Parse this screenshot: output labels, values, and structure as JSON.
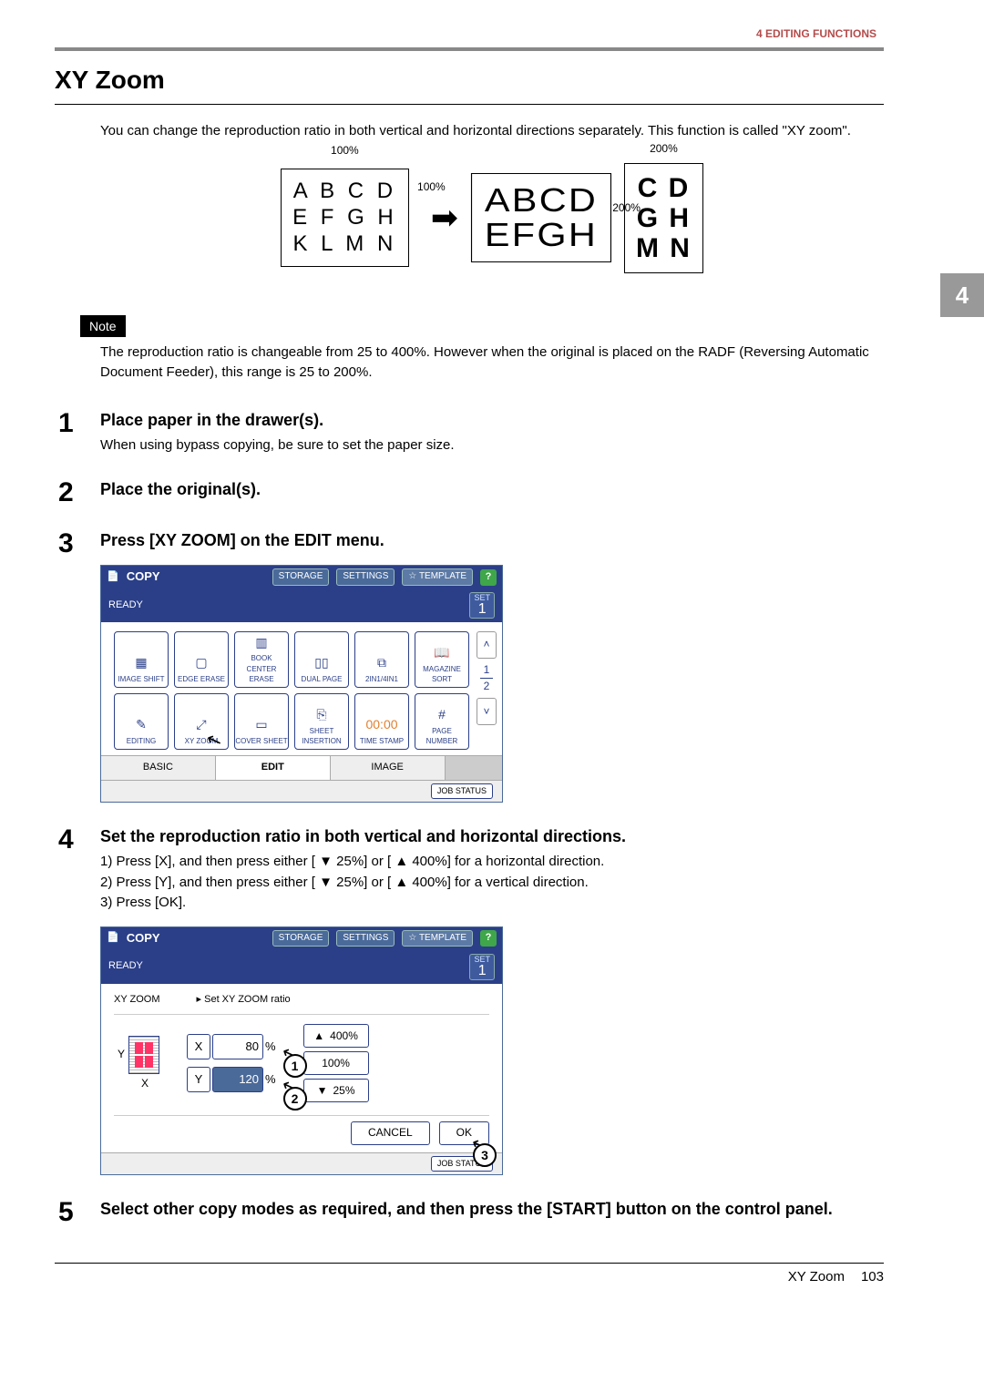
{
  "header": {
    "crumb": "4 EDITING FUNCTIONS",
    "chapter_tab": "4"
  },
  "title": "XY Zoom",
  "intro": "You can change the reproduction ratio in both vertical and horizontal directions separately. This function is called \"XY zoom\".",
  "figure": {
    "pct100_top": "100%",
    "pct100_side": "100%",
    "pct200_side": "200%",
    "pct200_top": "200%",
    "rows_orig": [
      "A B C D",
      "E F G H",
      "K L M N"
    ],
    "rows_wide": [
      "ABCD",
      "EFGH"
    ],
    "rows_tall": [
      "C D",
      "G H",
      "M N"
    ]
  },
  "note": {
    "label": "Note",
    "text": "The reproduction ratio is changeable from 25 to 400%. However when the original is placed on the RADF (Reversing Automatic Document Feeder), this range is 25 to 200%."
  },
  "steps": {
    "s1": {
      "num": "1",
      "heading": "Place paper in the drawer(s).",
      "text": "When using bypass copying, be sure to set the paper size."
    },
    "s2": {
      "num": "2",
      "heading": "Place the original(s)."
    },
    "s3": {
      "num": "3",
      "heading": "Press [XY ZOOM] on the EDIT menu."
    },
    "s4": {
      "num": "4",
      "heading": "Set the reproduction ratio in both vertical and horizontal directions.",
      "l1": "1)  Press [X], and then press either [ ▼ 25%] or [ ▲ 400%] for a horizontal direction.",
      "l2": "2)  Press [Y], and then press either [ ▼ 25%] or [ ▲ 400%] for a vertical direction.",
      "l3": "3)  Press [OK]."
    },
    "s5": {
      "num": "5",
      "heading": "Select other copy modes as required, and then press the [START] button on the control panel."
    }
  },
  "panel_common": {
    "copy": "COPY",
    "storage": "STORAGE",
    "settings": "SETTINGS",
    "template": "☆ TEMPLATE",
    "ready": "READY",
    "set": "SET",
    "one": "1",
    "job_status": "JOB STATUS"
  },
  "edit_panel": {
    "cells": [
      "IMAGE SHIFT",
      "EDGE ERASE",
      "BOOK CENTER ERASE",
      "DUAL PAGE",
      "2IN1/4IN1",
      "MAGAZINE SORT",
      "EDITING",
      "XY ZOOM",
      "COVER SHEET",
      "SHEET INSERTION",
      "TIME STAMP",
      "PAGE NUMBER"
    ],
    "time_stamp_icon": "00:00",
    "side": {
      "up": "˄",
      "p1": "1",
      "p2": "2",
      "down": "˅"
    },
    "tabs": {
      "basic": "BASIC",
      "edit": "EDIT",
      "image": "IMAGE"
    }
  },
  "ratio_panel": {
    "title_left": "XY ZOOM",
    "title_right": "▸ Set XY ZOOM ratio",
    "preview": {
      "y": "Y",
      "x": "X"
    },
    "x_row": {
      "label": "X",
      "value": "80",
      "unit": "%"
    },
    "y_row": {
      "label": "Y",
      "value": "120",
      "unit": "%"
    },
    "btn400": "400%",
    "btn100": "100%",
    "btn25": "25%",
    "cancel": "CANCEL",
    "ok": "OK",
    "callout1": "1",
    "callout2": "2",
    "callout3": "3"
  },
  "footer": {
    "section": "XY Zoom",
    "page": "103"
  }
}
